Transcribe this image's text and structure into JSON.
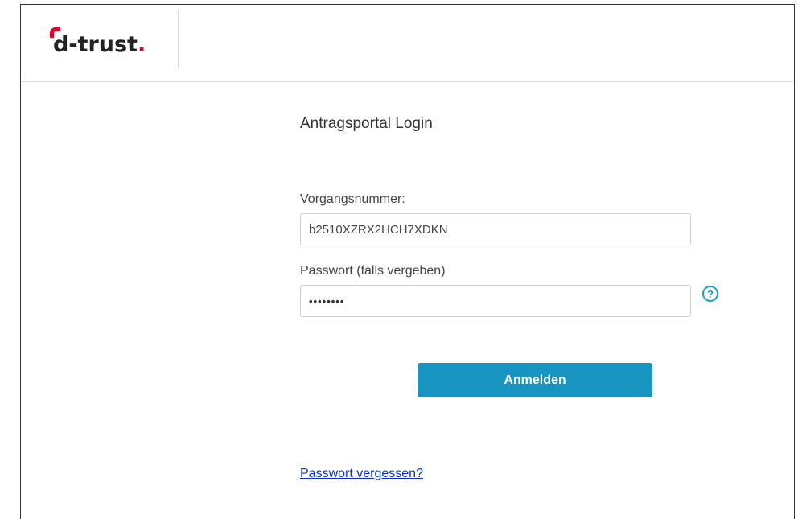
{
  "header": {
    "logo_text": "d-trust",
    "logo_dot": ".",
    "logo_accent": "#e3002b"
  },
  "login": {
    "title": "Antragsportal Login",
    "case_number_label": "Vorgangsnummer:",
    "case_number_value": "b2510XZRX2HCH7XDKN",
    "password_label": "Passwort (falls vergeben)",
    "password_value": "••••••••",
    "help_icon": "?",
    "submit_label": "Anmelden",
    "forgot_link": "Passwort vergessen?"
  },
  "colors": {
    "button": "#1795c0",
    "help_icon": "#1aa0c8",
    "link": "#0a36c8"
  }
}
